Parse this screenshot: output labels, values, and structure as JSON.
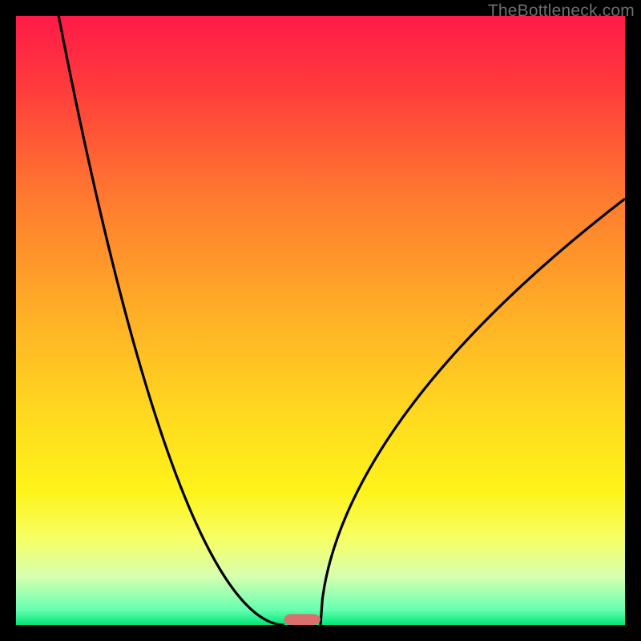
{
  "watermark": {
    "text": "TheBottleneck.com"
  },
  "chart_data": {
    "type": "line",
    "xlim": [
      0,
      100
    ],
    "ylim": [
      0,
      100
    ],
    "x_axis_visible": false,
    "y_axis_visible": false,
    "legend": false,
    "grid": false,
    "gradient_stops": [
      {
        "offset": 0.0,
        "color": "#ff1a47"
      },
      {
        "offset": 0.12,
        "color": "#ff3c3c"
      },
      {
        "offset": 0.3,
        "color": "#ff7a2f"
      },
      {
        "offset": 0.5,
        "color": "#ffb226"
      },
      {
        "offset": 0.65,
        "color": "#ffd81f"
      },
      {
        "offset": 0.78,
        "color": "#fff31a"
      },
      {
        "offset": 0.86,
        "color": "#f6ff66"
      },
      {
        "offset": 0.92,
        "color": "#d7ffb0"
      },
      {
        "offset": 0.975,
        "color": "#66ffb0"
      },
      {
        "offset": 1.0,
        "color": "#00e676"
      }
    ],
    "curves": {
      "left": {
        "start_x": 7,
        "start_y": 100,
        "end_x": 44,
        "end_y": 0,
        "shape_exponent": 1.9
      },
      "right": {
        "start_x": 50,
        "start_y": 0,
        "end_x": 100,
        "end_y": 70,
        "shape_exponent": 0.55
      }
    },
    "minimum_marker": {
      "x_center": 47,
      "y": 0,
      "width": 6,
      "height": 1.8,
      "fill": "#d9706e",
      "rx": 1.2
    },
    "curve_style": {
      "stroke": "#000000",
      "stroke_width": 3.2
    }
  }
}
